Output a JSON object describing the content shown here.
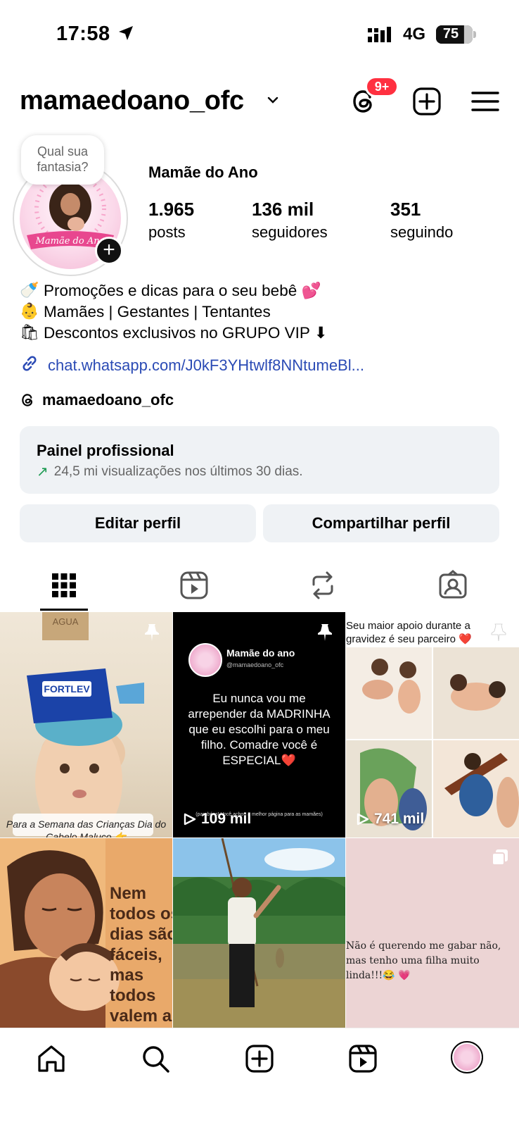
{
  "status_bar": {
    "time": "17:58",
    "network": "4G",
    "battery": "75",
    "battery_level": 0.75
  },
  "header": {
    "username": "mamaedoano_ofc",
    "threads_badge": "9+"
  },
  "profile": {
    "note": "Qual sua fantasia?",
    "avatar_text": "Mamãe do Ano",
    "display_name": "Mamãe do Ano",
    "stats": [
      {
        "value": "1.965",
        "label": "posts"
      },
      {
        "value": "136 mil",
        "label": "seguidores"
      },
      {
        "value": "351",
        "label": "seguindo"
      }
    ],
    "bio": [
      {
        "emoji": "🍼",
        "text": "Promoções e dicas para o seu bebê 💕"
      },
      {
        "emoji": "👶",
        "text": "Mamães | Gestantes | Tentantes"
      },
      {
        "emoji": "🛍",
        "text": "Descontos exclusivos no GRUPO VIP ⬇"
      }
    ],
    "link": "chat.whatsapp.com/J0kF3YHtwlf8NNtumeBl...",
    "threads_handle": "mamaedoano_ofc"
  },
  "dashboard": {
    "title": "Painel profissional",
    "subtitle": "24,5 mi visualizações nos últimos 30 dias."
  },
  "buttons": {
    "edit": "Editar perfil",
    "share": "Compartilhar perfil"
  },
  "posts": [
    {
      "caption": "Para a Semana das Crianças Dia do Cabelo Maluco 👉",
      "sign_text": "AGUA",
      "bucket_text": "FORTLEV",
      "pinned": true
    },
    {
      "views": "109 mil",
      "pinned": true,
      "brand": "Mamãe do ano",
      "handle": "@mamaedoano_ofc",
      "text": "Eu nunca vou me arrepender da MADRINHA que eu escolhi para o meu filho. Comadre você é ESPECIAL❤️",
      "footer": "(parabéns! Você achou a melhor página para as mamães)"
    },
    {
      "views": "741 mil",
      "pinned": true,
      "title": "Seu maior apoio durante a gravidez é seu parceiro ❤️"
    },
    {
      "text": "Nem todos os dias são fáceis, mas todos valem a pena"
    },
    {
      "reel": true
    },
    {
      "multi": true,
      "text": "Não é querendo me gabar não, mas tenho uma filha muito linda!!!😂 💗"
    }
  ]
}
